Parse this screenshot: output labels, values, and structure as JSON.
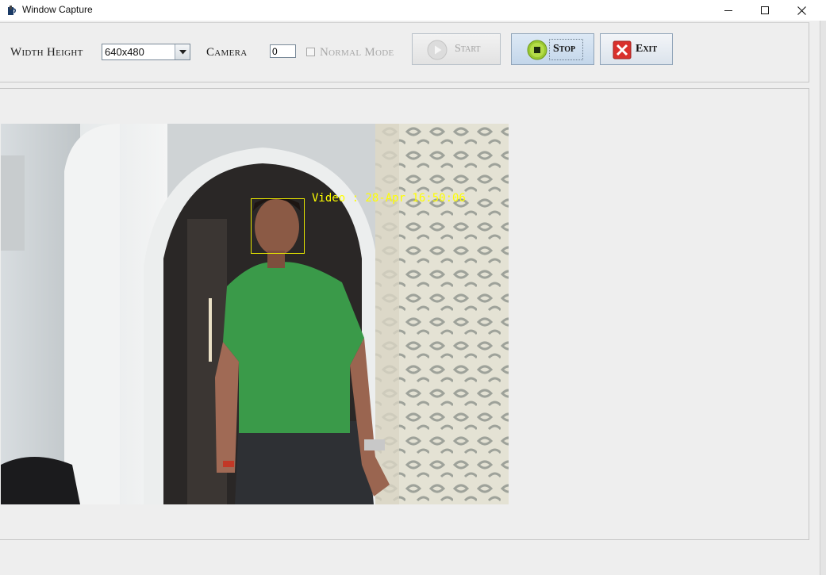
{
  "window": {
    "title": "Window Capture",
    "controls": [
      "minimize-icon",
      "maximize-icon",
      "close-icon"
    ]
  },
  "toolbar": {
    "width_height_label": "Width Height",
    "resolution": {
      "selected": "640x480"
    },
    "camera_label": "Camera",
    "camera_value": "0",
    "normal_mode": {
      "label": "Normal Mode",
      "checked": false,
      "enabled": false
    },
    "start_button": {
      "label": "Start",
      "enabled": false,
      "icon": "play-icon"
    },
    "stop_button": {
      "label": "Stop",
      "enabled": true,
      "icon": "stop-icon"
    },
    "exit_button": {
      "label": "Exit",
      "enabled": true,
      "icon": "close-x-icon"
    }
  },
  "video": {
    "overlay_text": "Video : 28-Apr 16:50:06",
    "overlay_color": "#ffff00",
    "face_box_color": "#e6e600"
  }
}
